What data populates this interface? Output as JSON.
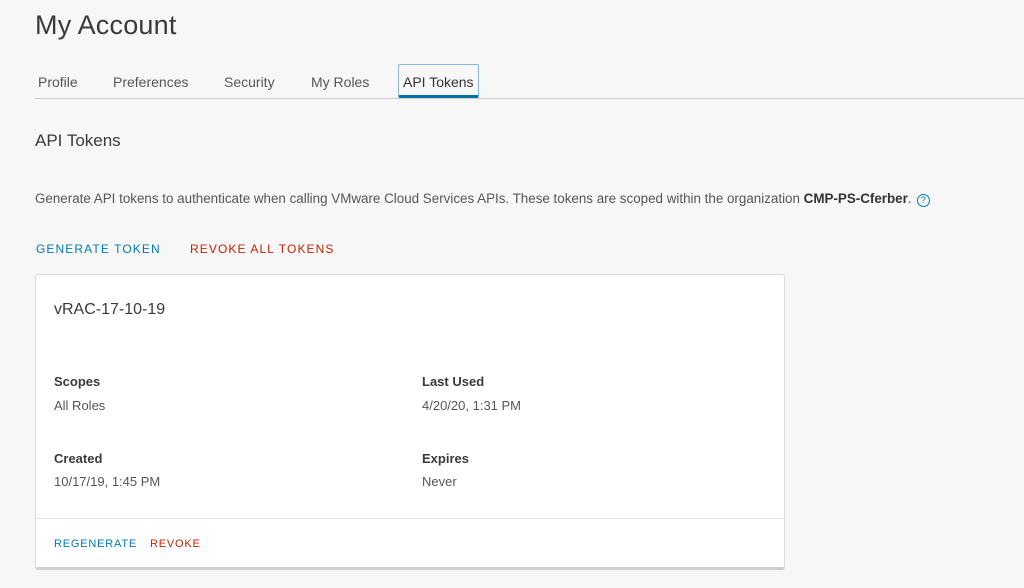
{
  "page": {
    "title": "My Account"
  },
  "tabs": [
    {
      "label": "Profile"
    },
    {
      "label": "Preferences"
    },
    {
      "label": "Security"
    },
    {
      "label": "My Roles"
    },
    {
      "label": "API Tokens"
    }
  ],
  "section": {
    "title": "API Tokens",
    "description_prefix": "Generate API tokens to authenticate when calling VMware Cloud Services APIs. These tokens are scoped within the organization ",
    "organization": "CMP-PS-Cferber",
    "description_suffix": ".",
    "help_icon": "question-circle-icon",
    "help_glyph": "?"
  },
  "actions": {
    "generate_label": "GENERATE TOKEN",
    "revoke_all_label": "REVOKE ALL TOKENS"
  },
  "token": {
    "name": "vRAC-17-10-19",
    "scopes_label": "Scopes",
    "scopes_value": "All Roles",
    "last_used_label": "Last Used",
    "last_used_value": "4/20/20, 1:31 PM",
    "created_label": "Created",
    "created_value": "10/17/19, 1:45 PM",
    "expires_label": "Expires",
    "expires_value": "Never",
    "regenerate_label": "REGENERATE",
    "revoke_label": "REVOKE"
  },
  "colors": {
    "link_blue": "#0079b8",
    "danger_red": "#c92100",
    "active_tab_underline": "#0072a3"
  }
}
